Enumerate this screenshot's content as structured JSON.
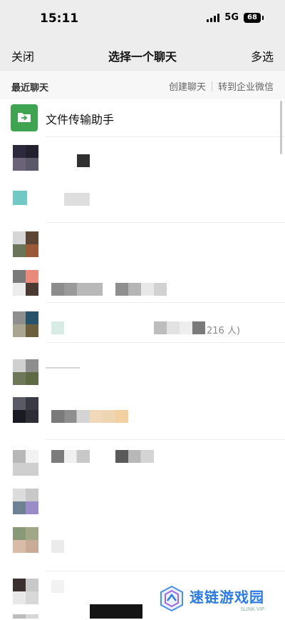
{
  "status_bar": {
    "time": "15:11",
    "network": "5G",
    "battery": "68"
  },
  "nav": {
    "close_label": "关闭",
    "title": "选择一个聊天",
    "multi_select_label": "多选"
  },
  "section": {
    "label": "最近聊天",
    "create_chat": "创建聊天",
    "forward_wecom": "转到企业微信"
  },
  "file_helper": {
    "name": "文件传输助手",
    "icon": "folder-icon",
    "icon_color": "#3fa451"
  },
  "partial_member_count": "216 人)",
  "watermark": {
    "brand_cn": "速链游戏园",
    "brand_en": "SLINK.VIP"
  },
  "colors": {
    "accent": "#3fa451",
    "nav_bg": "#ededed",
    "section_bg": "#f7f7f7"
  }
}
